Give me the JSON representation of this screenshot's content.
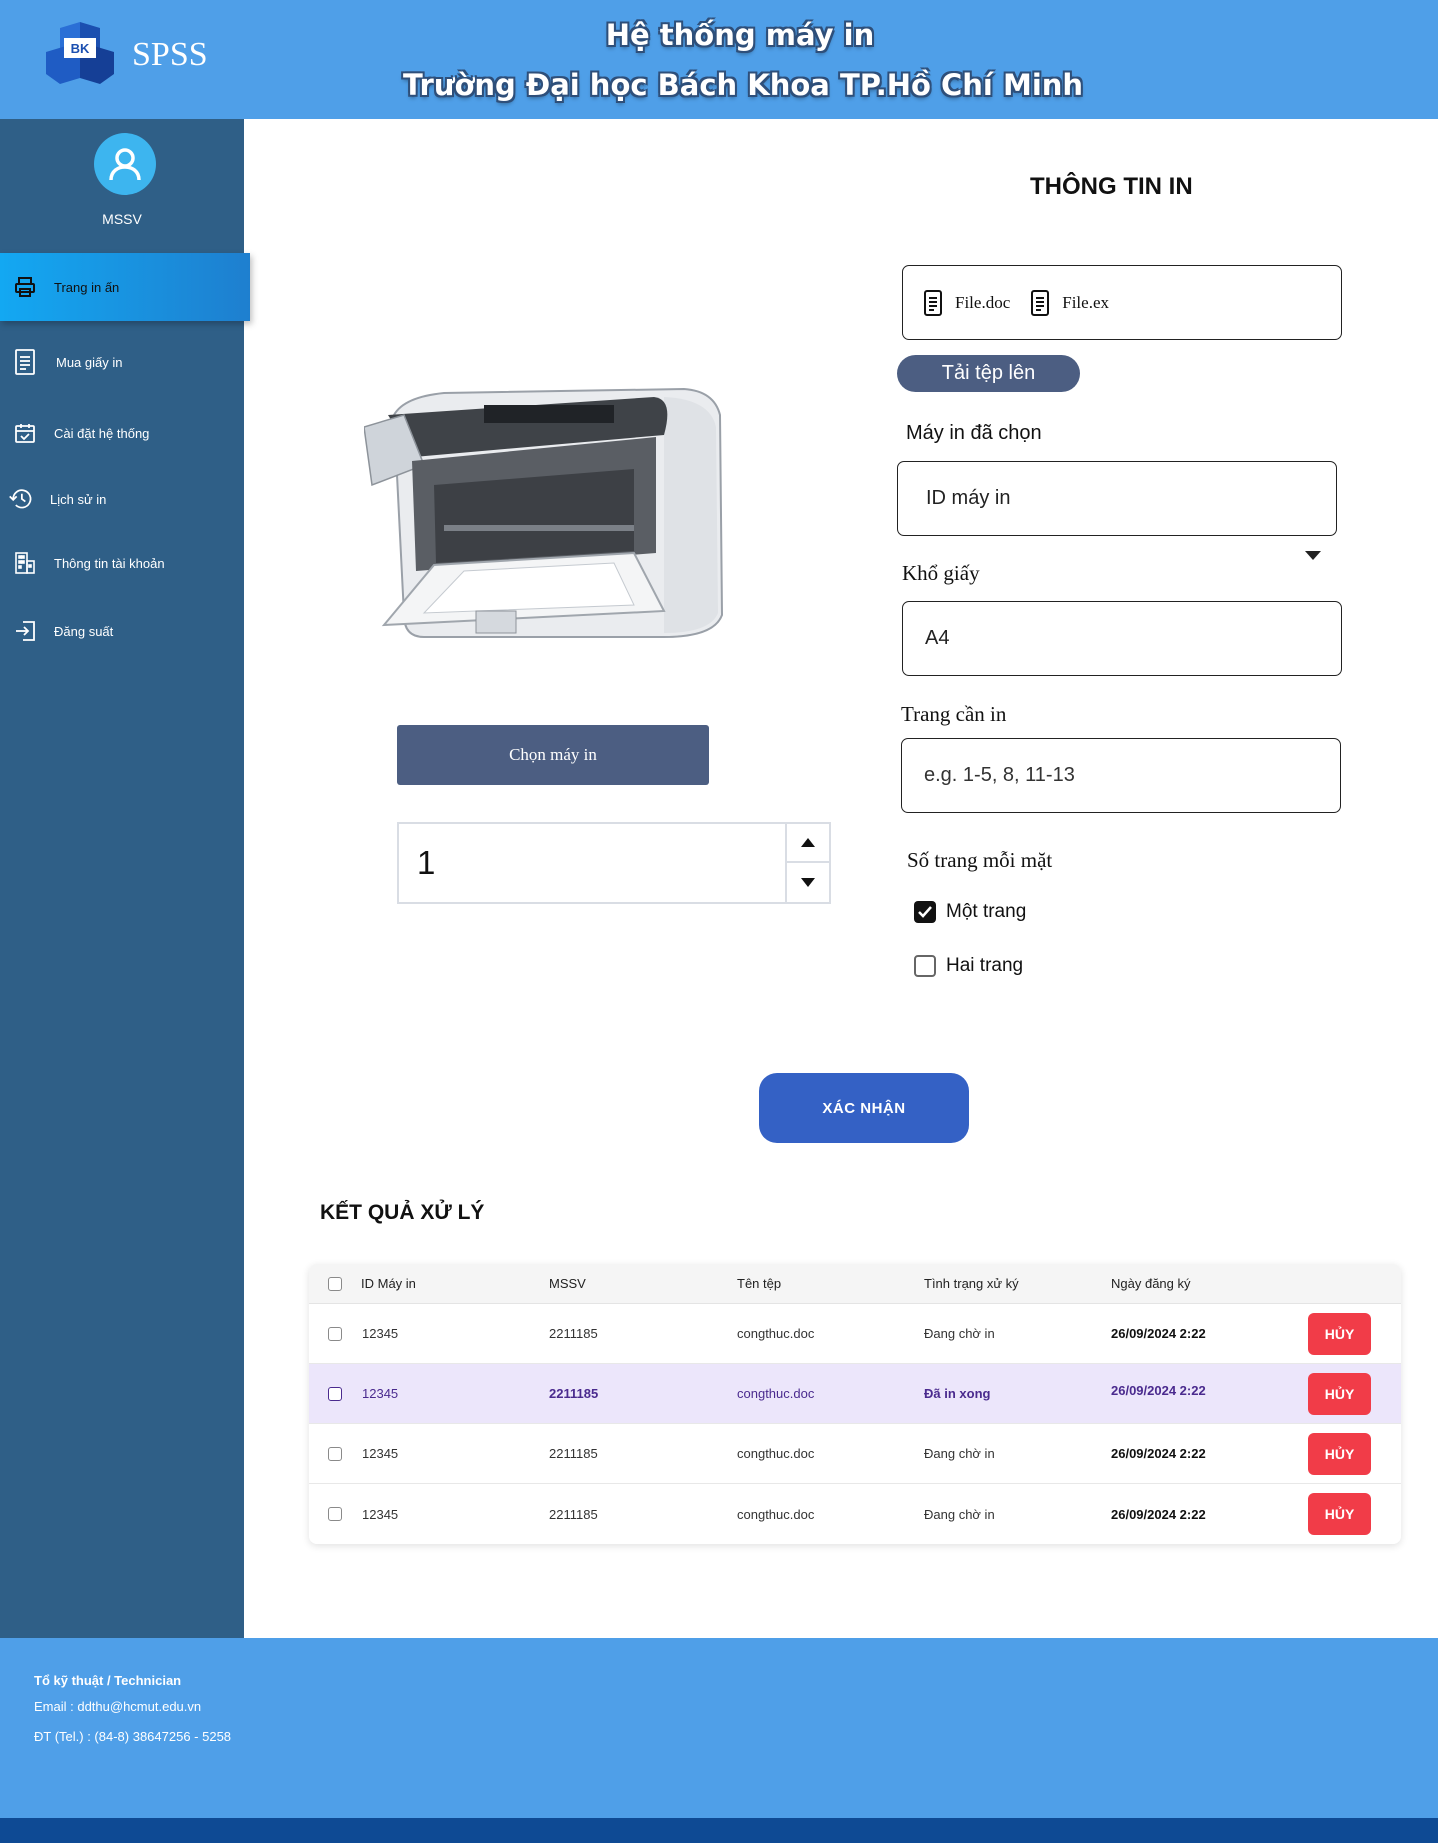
{
  "header": {
    "brand": "SPSS",
    "title_line1": "Hệ thống máy in",
    "title_line2": "Trường Đại học Bách Khoa TP.Hồ Chí Minh",
    "logo_text": "BK"
  },
  "sidebar": {
    "user_label": "MSSV",
    "items": [
      {
        "label": "Trang in ấn",
        "icon": "printer-icon",
        "active": true
      },
      {
        "label": "Mua giấy in",
        "icon": "document-icon"
      },
      {
        "label": "Cài đặt hệ thống",
        "icon": "calendar-check-icon"
      },
      {
        "label": "Lịch sử in",
        "icon": "history-icon"
      },
      {
        "label": "Thông tin tài khoản",
        "icon": "building-icon"
      },
      {
        "label": "Đăng suất",
        "icon": "logout-icon"
      }
    ]
  },
  "left_panel": {
    "choose_printer_label": "Chọn máy in",
    "copies_value": "1"
  },
  "print_info": {
    "title": "THÔNG TIN IN",
    "files": [
      "File.doc",
      "File.ex"
    ],
    "upload_label": "Tải tệp lên",
    "printer_label": "Máy in đã chọn",
    "printer_value": "ID máy in",
    "paper_size_label": "Khổ giấy",
    "paper_size_value": "A4",
    "pages_label": "Trang cần in",
    "pages_placeholder": "e.g. 1-5, 8, 11-13",
    "pages_per_side_label": "Số trang mỗi mặt",
    "option_one": "Một trang",
    "option_two": "Hai trang",
    "option_one_checked": true,
    "option_two_checked": false,
    "confirm_label": "XÁC NHẬN"
  },
  "results": {
    "title": "KẾT QUẢ XỬ LÝ",
    "columns": [
      "ID Máy in",
      "MSSV",
      "Tên tệp",
      "Tình trạng xử ký",
      "Ngày đăng ký"
    ],
    "cancel_label": "HỦY",
    "rows": [
      {
        "printer_id": "12345",
        "mssv": "2211185",
        "file": "congthuc.doc",
        "status": "Đang chờ in",
        "date": "26/09/2024 2:22"
      },
      {
        "printer_id": "12345",
        "mssv": "2211185",
        "file": "congthuc.doc",
        "status": "Đã in xong",
        "date": "26/09/2024 2:22"
      },
      {
        "printer_id": "12345",
        "mssv": "2211185",
        "file": "congthuc.doc",
        "status": "Đang chờ in",
        "date": "26/09/2024 2:22"
      },
      {
        "printer_id": "12345",
        "mssv": "2211185",
        "file": "congthuc.doc",
        "status": "Đang chờ in",
        "date": "26/09/2024 2:22"
      }
    ]
  },
  "footer": {
    "team": "Tổ kỹ thuật  / Technician",
    "email": "Email : ddthu@hcmut.edu.vn",
    "phone": "ĐT (Tel.) : (84-8) 38647256 - 5258"
  },
  "colors": {
    "header_bg": "#4f9fe8",
    "sidebar_bg": "#2f5f87",
    "active_nav": "#13a8f2",
    "button_slate": "#4c5e82",
    "confirm_blue": "#3461c5",
    "cancel_red": "#f13c48",
    "highlight_row": "#ece6fb",
    "footer_bar": "#0e4a94"
  }
}
